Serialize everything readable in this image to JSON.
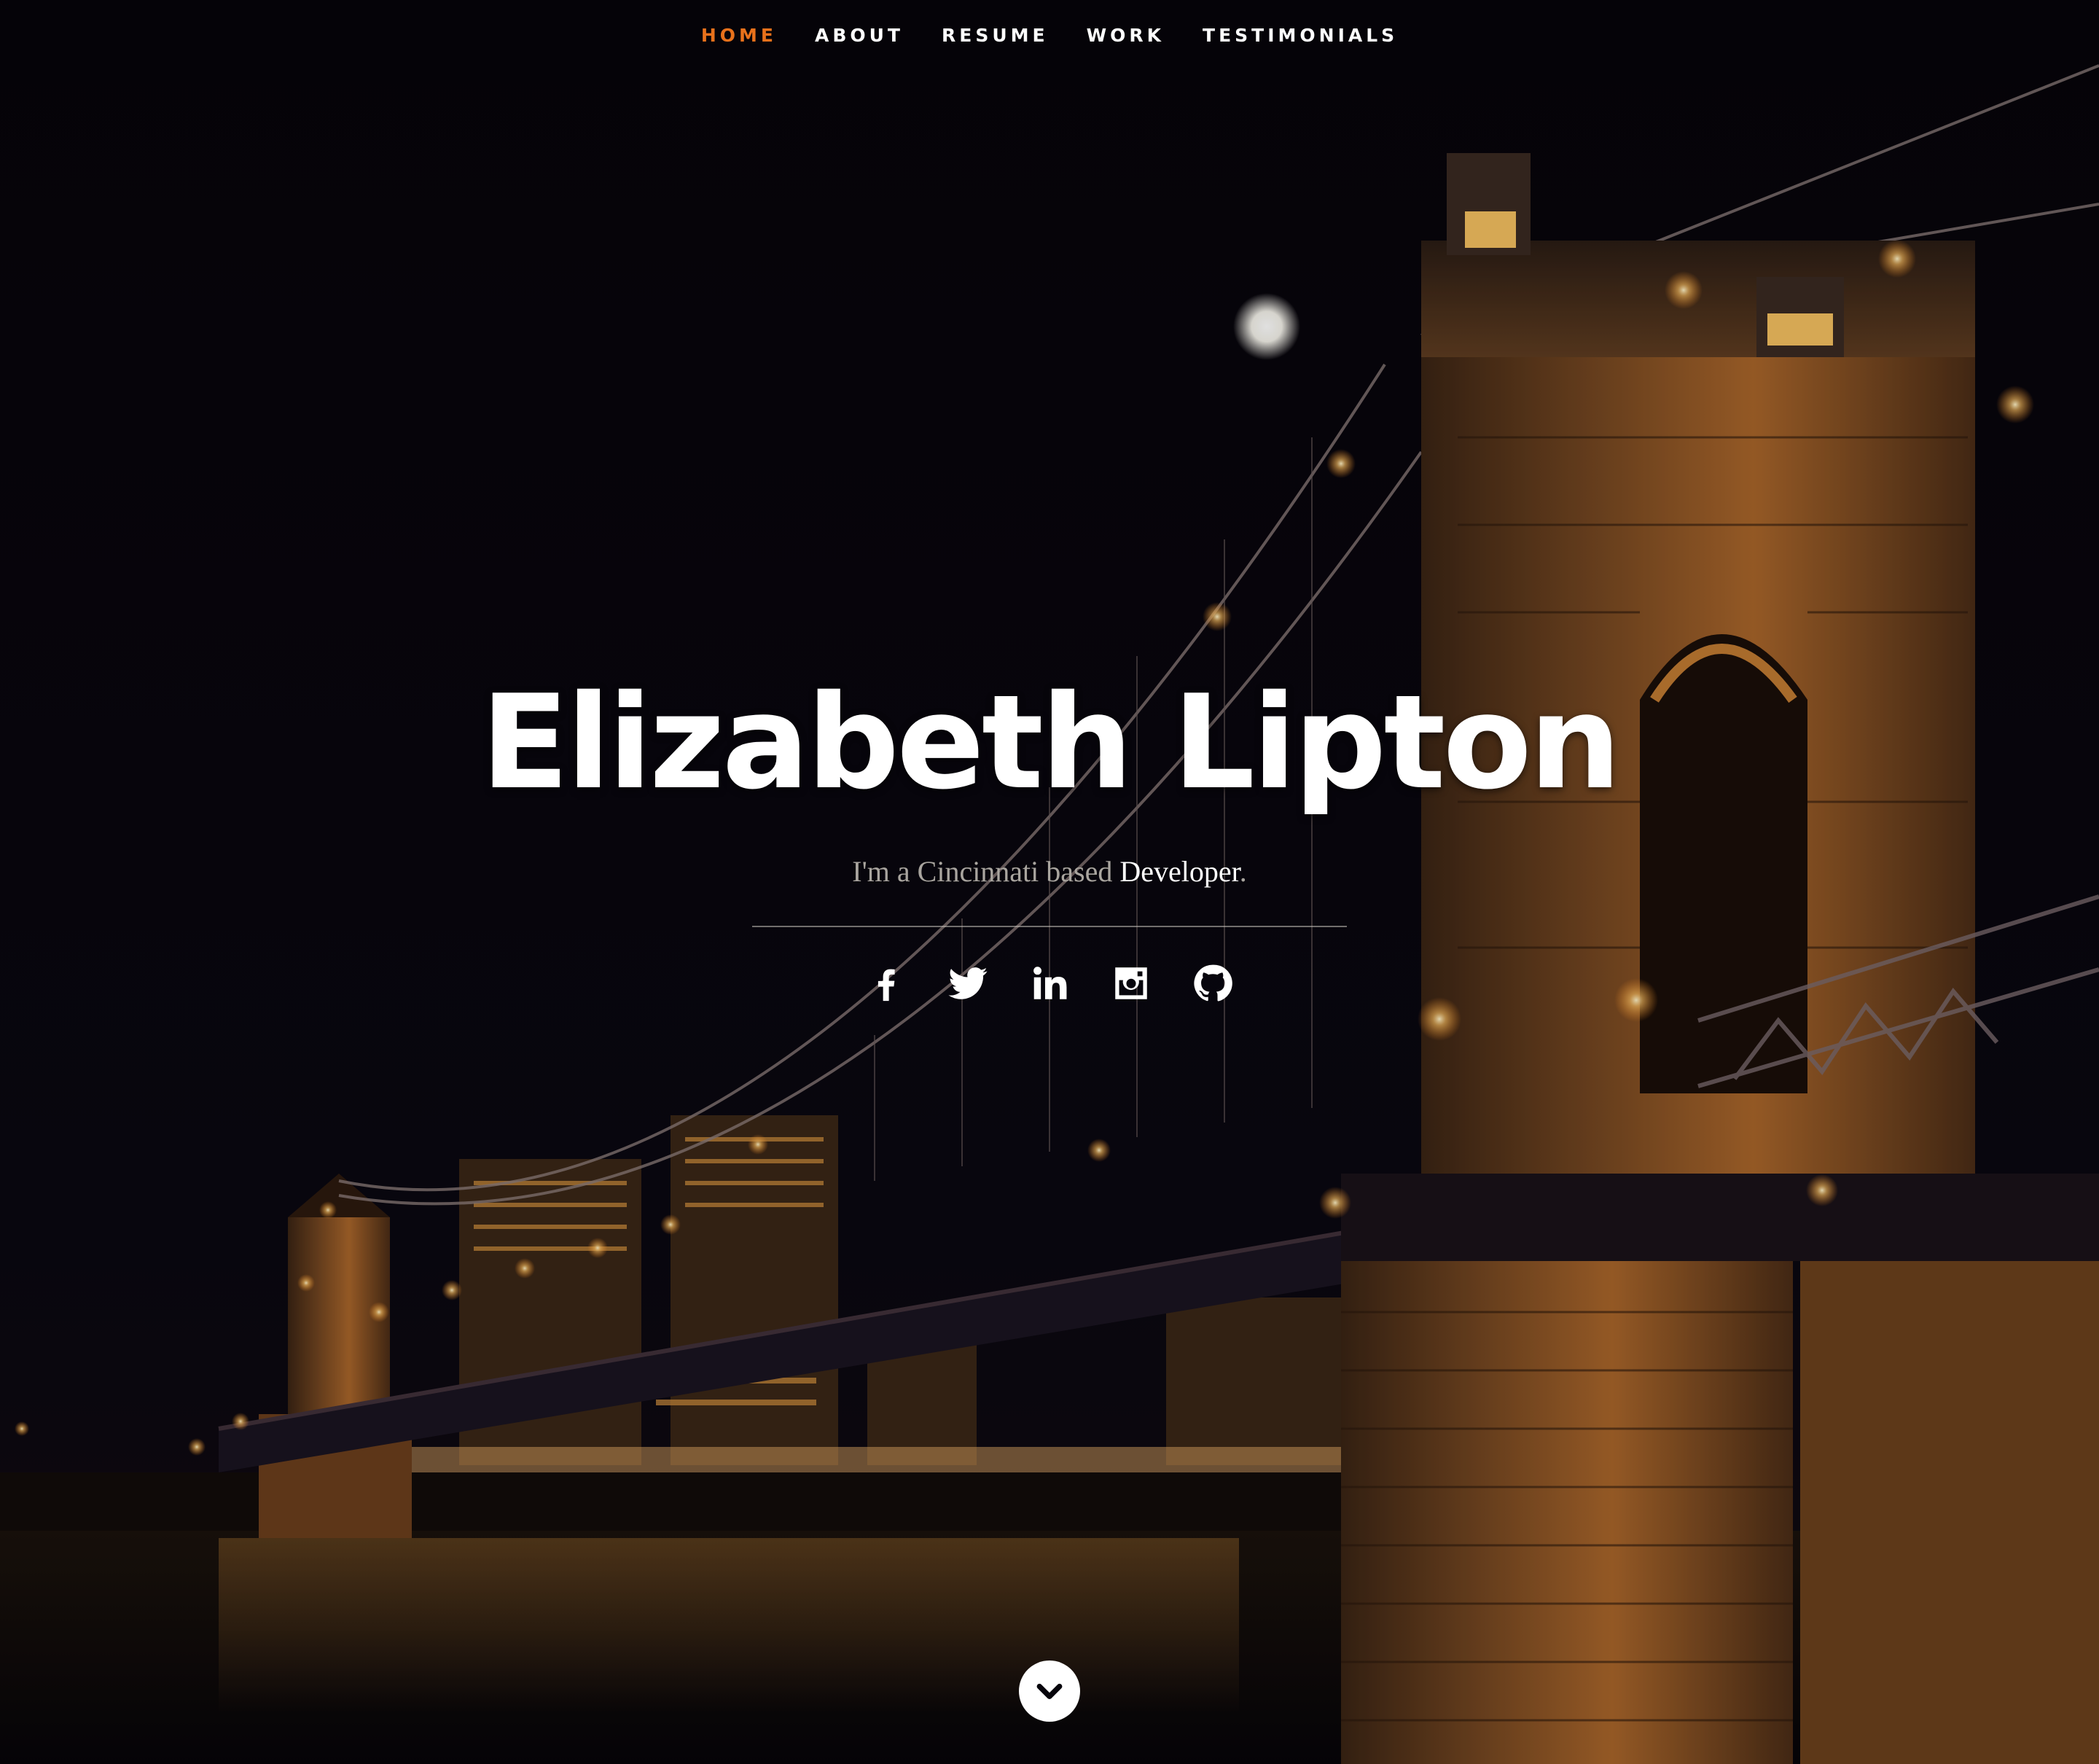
{
  "nav": {
    "items": [
      {
        "label": "HOME",
        "active": true
      },
      {
        "label": "ABOUT",
        "active": false
      },
      {
        "label": "RESUME",
        "active": false
      },
      {
        "label": "WORK",
        "active": false
      },
      {
        "label": "TESTIMONIALS",
        "active": false
      }
    ]
  },
  "hero": {
    "name": "Elizabeth Lipton",
    "tagline_prefix": "I'm a Cincinnati based ",
    "tagline_role": "Developer",
    "tagline_suffix": "."
  },
  "social": [
    {
      "icon": "facebook-icon"
    },
    {
      "icon": "twitter-icon"
    },
    {
      "icon": "linkedin-icon"
    },
    {
      "icon": "instagram-icon"
    },
    {
      "icon": "github-icon"
    }
  ],
  "scroll_button": {
    "icon": "chevron-down-icon"
  },
  "colors": {
    "accent": "#e8711b",
    "background": "#07050c",
    "text": "#ffffff",
    "muted_text": "#a9a59f"
  }
}
